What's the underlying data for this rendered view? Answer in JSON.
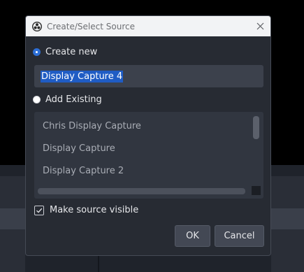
{
  "dialog": {
    "title": "Create/Select Source",
    "close_icon": "close-icon",
    "create_new_label": "Create new",
    "create_new_checked": true,
    "name_value": "Display Capture 4",
    "add_existing_label": "Add Existing",
    "add_existing_checked": false,
    "existing_sources": [
      "Chris Display Capture",
      "Display Capture",
      "Display Capture 2"
    ],
    "visible_label": "Make source visible",
    "visible_checked": true,
    "ok_label": "OK",
    "cancel_label": "Cancel"
  },
  "colors": {
    "accent": "#2d6fd6",
    "selection": "#1f5cc4",
    "dialog_bg": "#272b33",
    "titlebar_bg": "#f2f3f5"
  }
}
